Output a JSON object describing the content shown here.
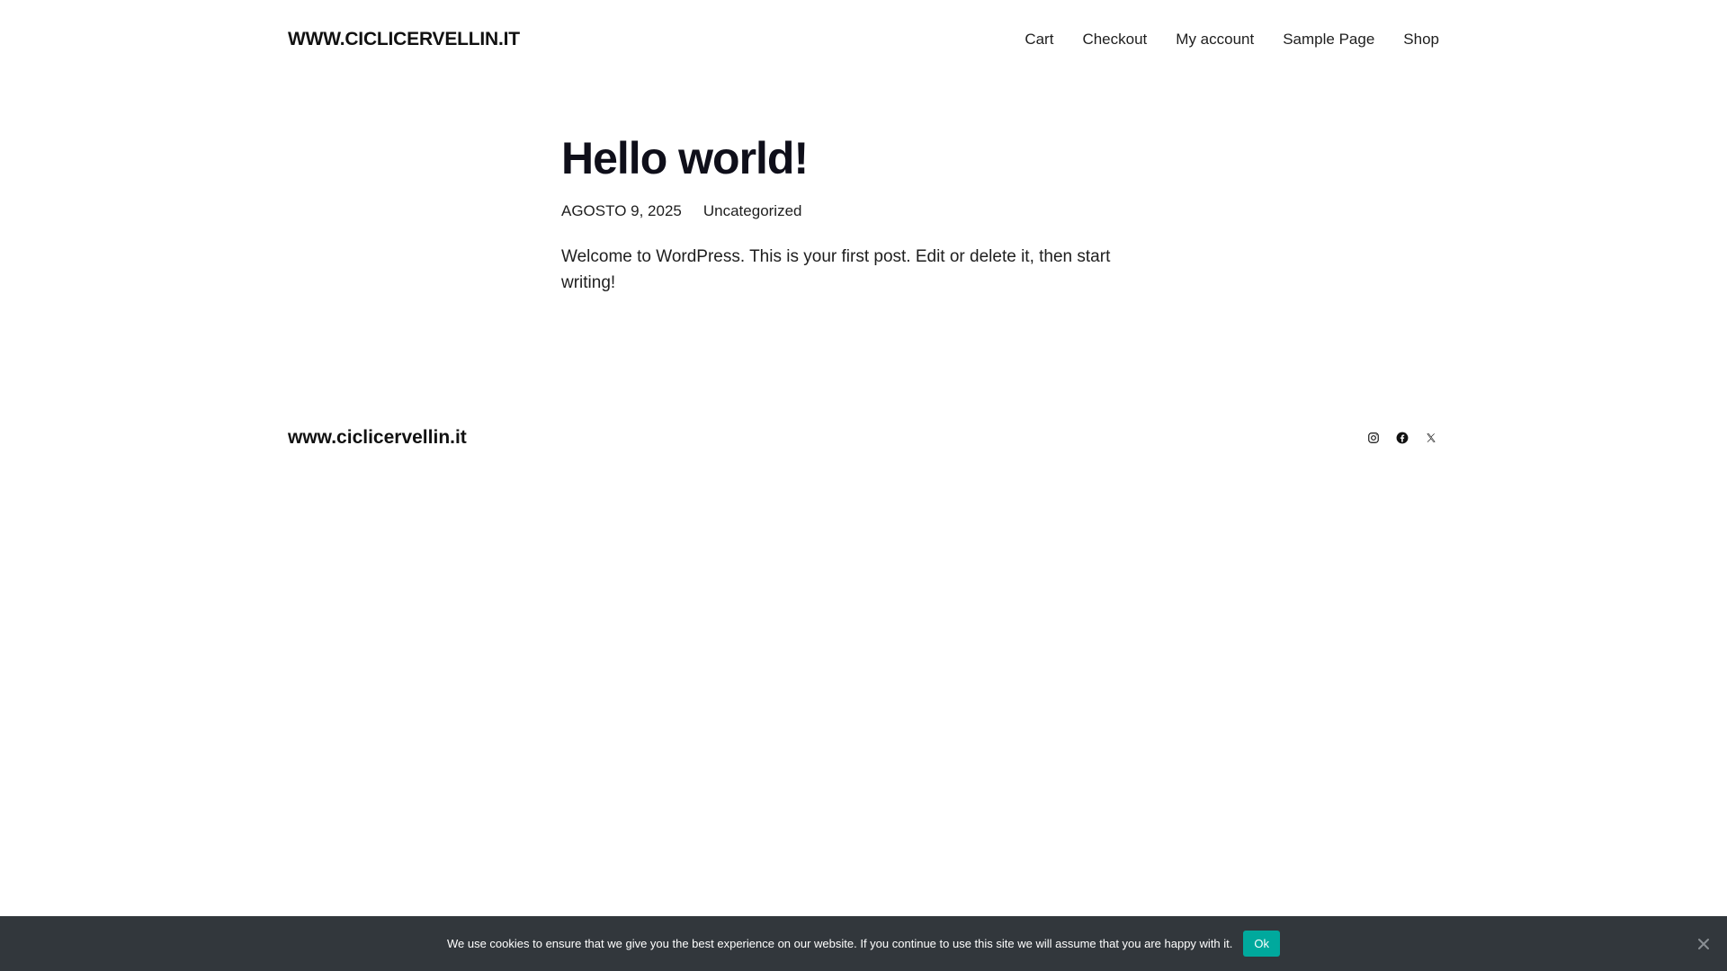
{
  "header": {
    "site_title": "WWW.CICLICERVELLIN.IT",
    "nav": [
      {
        "label": "Cart"
      },
      {
        "label": "Checkout"
      },
      {
        "label": "My account"
      },
      {
        "label": "Sample Page"
      },
      {
        "label": "Shop"
      }
    ]
  },
  "post": {
    "title": "Hello world!",
    "date": "AGOSTO 9, 2025",
    "category": "Uncategorized",
    "content": "Welcome to WordPress. This is your first post. Edit or delete it, then start writing!"
  },
  "footer": {
    "site_title": "www.ciclicervellin.it",
    "social": [
      {
        "icon": "instagram-icon"
      },
      {
        "icon": "facebook-icon"
      },
      {
        "icon": "x-icon"
      }
    ]
  },
  "cookie_bar": {
    "message": "We use cookies to ensure that we give you the best experience on our website. If you continue to use this site we will assume that you are happy with it.",
    "ok_label": "Ok",
    "background": "#32373c",
    "accent": "#00a99d"
  }
}
